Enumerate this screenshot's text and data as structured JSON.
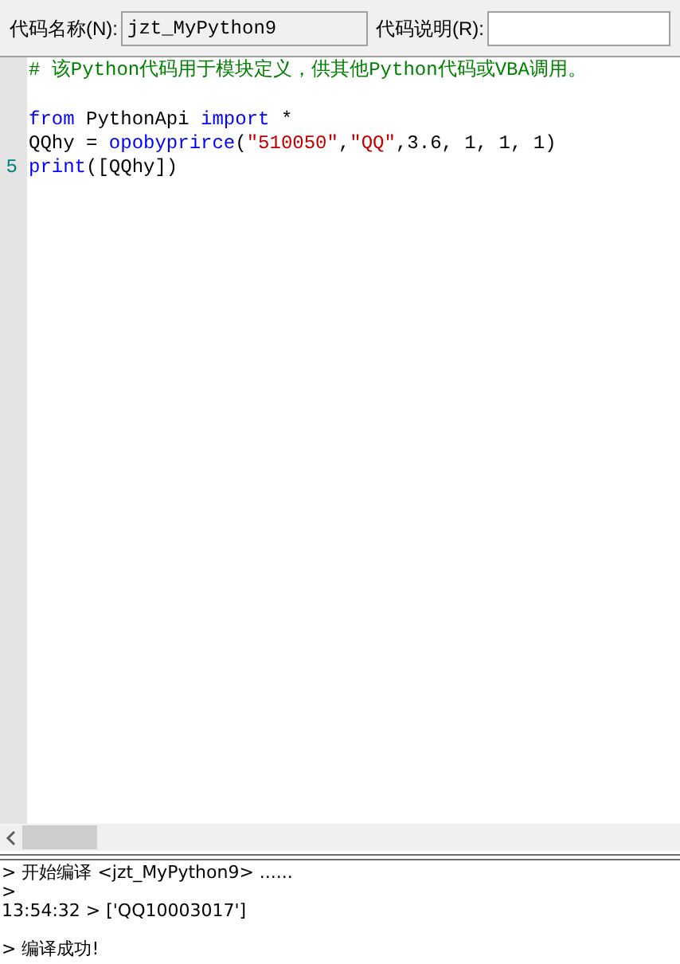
{
  "header": {
    "name_label": "代码名称(N):",
    "name_value": "jzt_MyPython9",
    "desc_label": "代码说明(R):"
  },
  "code_lines": [
    {
      "tokens": [
        {
          "kind": "comment",
          "text": "# 该Python代码用于模块定义，供其他Python代码或VBA调用。"
        }
      ]
    },
    {
      "blank_before": true,
      "tokens": [
        {
          "kind": "keyword",
          "text": "from"
        },
        {
          "kind": "plain",
          "text": " PythonApi "
        },
        {
          "kind": "keyword",
          "text": "import"
        },
        {
          "kind": "plain",
          "text": " *"
        }
      ]
    },
    {
      "tokens": [
        {
          "kind": "plain",
          "text": "QQhy = "
        },
        {
          "kind": "func",
          "text": "opobyprirce"
        },
        {
          "kind": "plain",
          "text": "("
        },
        {
          "kind": "string",
          "text": "″510050″"
        },
        {
          "kind": "plain",
          "text": ","
        },
        {
          "kind": "string",
          "text": "″QQ″"
        },
        {
          "kind": "plain",
          "text": ",3.6, 1, 1, 1)"
        }
      ]
    },
    {
      "line_number": "5",
      "tokens": [
        {
          "kind": "func",
          "text": "print"
        },
        {
          "kind": "plain",
          "text": "([QQhy])"
        }
      ]
    }
  ],
  "output_lines": [
    "> 开始编译 <jzt_MyPython9> ......",
    ">",
    "13:54:32 > ['QQ10003017']"
  ],
  "output_status": "> 编译成功!"
}
